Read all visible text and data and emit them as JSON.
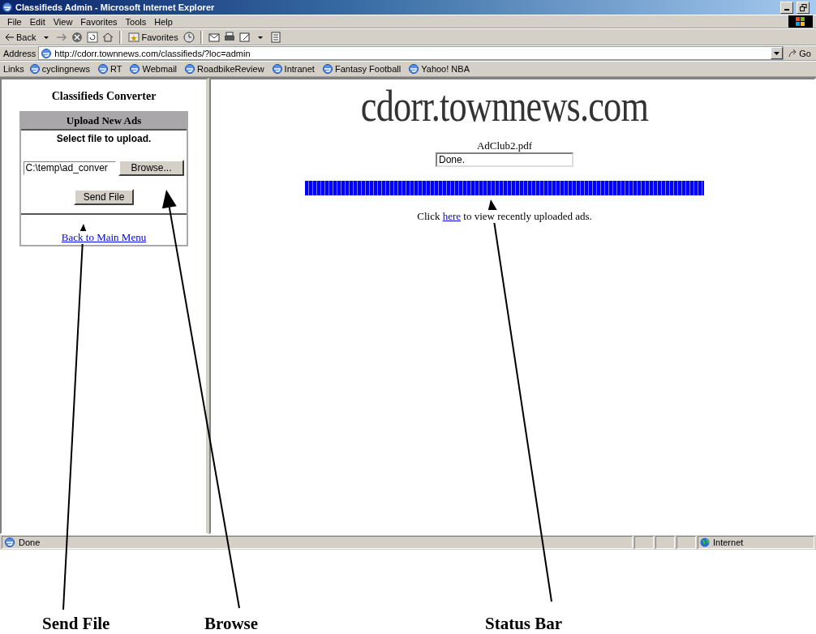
{
  "window": {
    "title": "Classifieds Admin - Microsoft Internet Explorer"
  },
  "menu": [
    "File",
    "Edit",
    "View",
    "Favorites",
    "Tools",
    "Help"
  ],
  "toolbar": {
    "back": "Back",
    "favorites": "Favorites"
  },
  "address": {
    "label": "Address",
    "value": "http://cdorr.townnews.com/classifieds/?loc=admin",
    "go": "Go"
  },
  "links": {
    "label": "Links",
    "items": [
      "cyclingnews",
      "RT",
      "Webmail",
      "RoadbikeReview",
      "Intranet",
      "Fantasy Football",
      "Yahoo! NBA"
    ]
  },
  "sidebar": {
    "title": "Classifieds Converter",
    "panel_title": "Upload New Ads",
    "prompt": "Select file to upload.",
    "file_field": {
      "value": "C:\\temp\\ad_conver"
    },
    "browse_button": "Browse...",
    "send_button": "Send File",
    "back_link": "Back to Main Menu"
  },
  "main": {
    "site_title": "cdorr.townnews.com",
    "file_name": "AdClub2.pdf",
    "status_field": {
      "value": "Done."
    },
    "progress": {
      "level": 1
    },
    "message_before": "Click ",
    "message_link": "here",
    "message_after": " to view recently uploaded ads."
  },
  "status_bar": {
    "text": "Done",
    "zone": "Internet"
  },
  "annotations": [
    {
      "label": "Send File"
    },
    {
      "label": "Browse"
    },
    {
      "label": "Status Bar"
    }
  ]
}
